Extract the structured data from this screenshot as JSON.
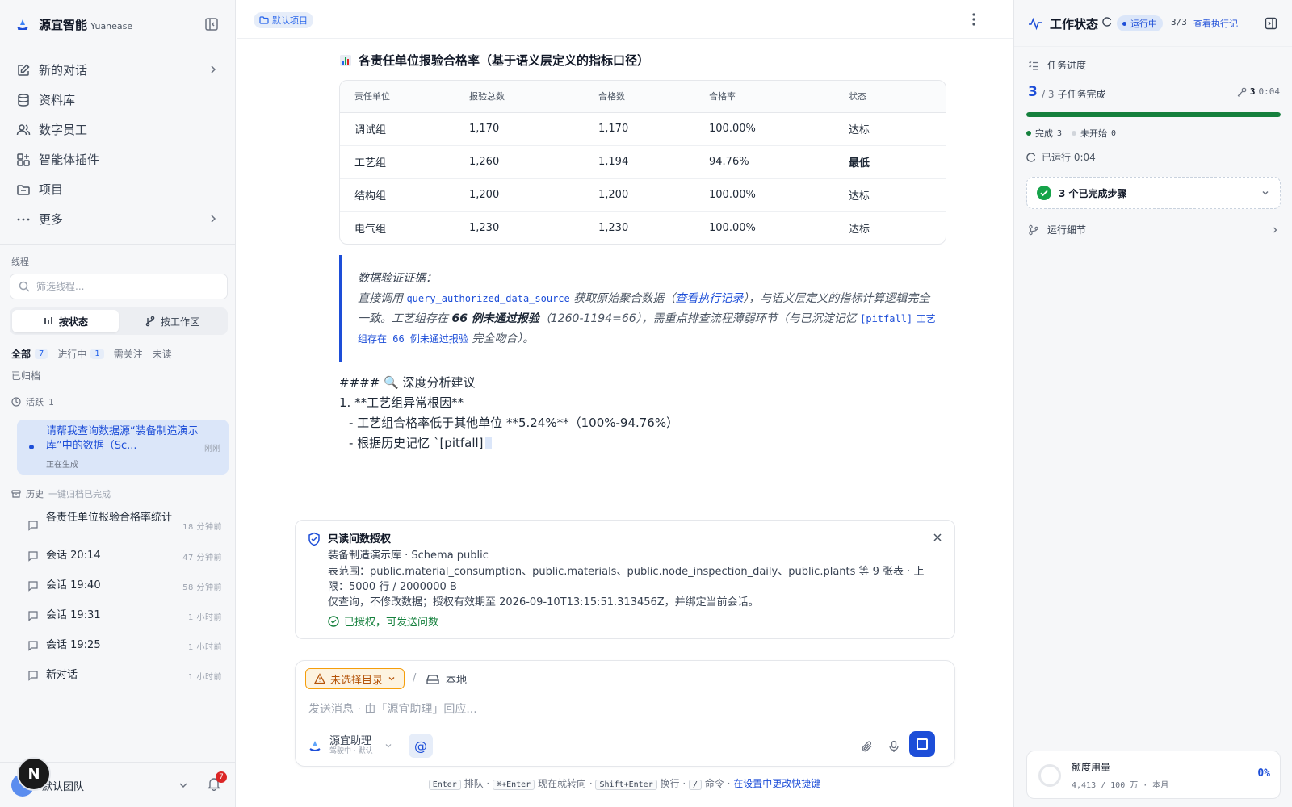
{
  "sidebar": {
    "brand": {
      "name": "源宜智能",
      "sub": "Yuanease"
    },
    "nav": [
      {
        "label": "新的对话"
      },
      {
        "label": "资料库"
      },
      {
        "label": "数字员工"
      },
      {
        "label": "智能体插件"
      },
      {
        "label": "项目"
      },
      {
        "label": "更多"
      }
    ],
    "threads_label": "线程",
    "filter_placeholder": "筛选线程...",
    "group_by": {
      "status": "按状态",
      "workspace": "按工作区"
    },
    "tabs": [
      {
        "label": "全部",
        "count": "7"
      },
      {
        "label": "进行中",
        "count": "1"
      },
      {
        "label": "需关注"
      },
      {
        "label": "未读"
      },
      {
        "label": "已归档"
      }
    ],
    "active_group": {
      "label": "活跃",
      "count": "1"
    },
    "active_thread": {
      "title": "请帮我查询数据源“装备制造演示库”中的数据（Sc...",
      "status": "正在生成",
      "time": "刚刚"
    },
    "history_group": {
      "label": "历史",
      "meta": "一键归档已完成"
    },
    "history": [
      {
        "title": "各责任单位报验合格率统计",
        "time": "18 分钟前"
      },
      {
        "title": "会话 20:14",
        "time": "47 分钟前"
      },
      {
        "title": "会话 19:40",
        "time": "58 分钟前"
      },
      {
        "title": "会话 19:31",
        "time": "1 小时前"
      },
      {
        "title": "会话 19:25",
        "time": "1 小时前"
      },
      {
        "title": "新对话",
        "time": "1 小时前"
      }
    ],
    "team": {
      "avatar": "N",
      "name": "默认团队",
      "notifications": "7"
    }
  },
  "main": {
    "project_chip": "默认项目",
    "section_title": "各责任单位报验合格率（基于语义层定义的指标口径）",
    "table": {
      "headers": [
        "责任单位",
        "报验总数",
        "合格数",
        "合格率",
        "状态"
      ],
      "rows": [
        [
          "调试组",
          "1,170",
          "1,170",
          "100.00%",
          "达标"
        ],
        [
          "工艺组",
          "1,260",
          "1,194",
          "94.76%",
          "最低"
        ],
        [
          "结构组",
          "1,200",
          "1,200",
          "100.00%",
          "达标"
        ],
        [
          "电气组",
          "1,230",
          "1,230",
          "100.00%",
          "达标"
        ]
      ]
    },
    "evidence": {
      "heading": "数据验证证据：",
      "t1": "直接调用 ",
      "code1": "query_authorized_data_source",
      "t2": " 获取原始聚合数据（",
      "link": "查看执行记录",
      "t3": "），与语义层定义的指标计算逻辑完全一致。工艺组存在 ",
      "strong": "66 例未通过报验",
      "t4": "（1260-1194=66），需重点排查流程薄弱环节（与已沉淀记忆 ",
      "code2": "[pitfall]",
      "code3": "工艺组存在 66 例未通过报验",
      "t5": " 完全吻合）。"
    },
    "markdown": [
      "#### 🔍 深度分析建议",
      "1. **工艺组异常根因**",
      "- 工艺组合格率低于其他单位 **5.24%**（100%-94.76%）",
      "- 根据历史记忆 `[pitfall]"
    ],
    "auth": {
      "title": "只读问数授权",
      "source": "装备制造演示库 · Schema public",
      "scope": "表范围：public.material_consumption、public.materials、public.node_inspection_daily、public.plants 等 9 张表 · 上限：5000 行 / 2000000 B",
      "note": "仅查询，不修改数据；授权有效期至 2026-09-10T13:15:51.313456Z，并绑定当前会话。",
      "status": "已授权，可发送问数"
    },
    "composer": {
      "dir_chip": "未选择目录",
      "slash": "/",
      "local": "本地",
      "placeholder": "发送消息 · 由「源宜助理」回应...",
      "agent_name": "源宜助理",
      "agent_sub": "驾驶中 · 默认",
      "at": "@"
    },
    "hints": {
      "k1": "Enter",
      "t1": " 排队 · ",
      "k2": "⌘+Enter",
      "t2": " 现在就转向 · ",
      "k3": "Shift+Enter",
      "t3": " 换行 · ",
      "k4": "/",
      "t4": " 命令 · ",
      "link": "在设置中更改快捷键"
    }
  },
  "rpanel": {
    "title": "工作状态",
    "run_status": "运行中",
    "fraction": "3/3",
    "view_link": "查看执行记",
    "progress_label": "任务进度",
    "done": "3",
    "progress_rest": "/ 3",
    "progress_suffix": "子任务完成",
    "keys": "3",
    "time": "0:04",
    "progress": 1.0,
    "legend_done": "完成",
    "legend_done_n": "3",
    "legend_todo": "未开始",
    "legend_todo_n": "0",
    "elapsed": "已运行 0:04",
    "steps": "3 个已完成步骤",
    "run_detail": "运行细节",
    "quota": {
      "title": "额度用量",
      "sub": "4,413 / 100 万 · 本月",
      "pct": "0%"
    },
    "colors": {
      "accent": "#1d4ed8",
      "success": "#15803d",
      "warn": "#b45309"
    }
  }
}
